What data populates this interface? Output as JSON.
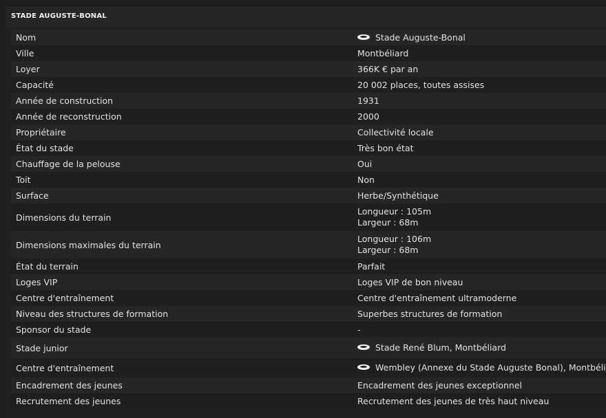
{
  "header": {
    "title": "STADE AUGUSTE-BONAL"
  },
  "rows": [
    {
      "label": "Nom",
      "value": [
        "Stade Auguste-Bonal"
      ],
      "icon": "stadium-icon",
      "h": 23
    },
    {
      "label": "Ville",
      "value": [
        "Montbéliard"
      ],
      "h": 23
    },
    {
      "label": "Loyer",
      "value": [
        "366K € par an"
      ],
      "h": 23
    },
    {
      "label": "Capacité",
      "value": [
        "20 002 places, toutes assises"
      ],
      "h": 23
    },
    {
      "label": "Année de construction",
      "value": [
        "1931"
      ],
      "h": 23
    },
    {
      "label": "Année de reconstruction",
      "value": [
        "2000"
      ],
      "h": 23
    },
    {
      "label": "Propriétaire",
      "value": [
        "Collectivité locale"
      ],
      "h": 23
    },
    {
      "label": "État du stade",
      "value": [
        "Très bon état"
      ],
      "h": 23
    },
    {
      "label": "Chauffage de la pelouse",
      "value": [
        "Oui"
      ],
      "h": 23
    },
    {
      "label": "Toit",
      "value": [
        "Non"
      ],
      "h": 23
    },
    {
      "label": "Surface",
      "value": [
        "Herbe/Synthétique"
      ],
      "h": 23
    },
    {
      "label": "Dimensions du terrain",
      "value": [
        "Longueur : 105m",
        "Largeur : 68m"
      ],
      "h": 40
    },
    {
      "label": "Dimensions maximales du terrain",
      "value": [
        "Longueur : 106m",
        "Largeur : 68m"
      ],
      "h": 40
    },
    {
      "label": "État du terrain",
      "value": [
        "Parfait"
      ],
      "h": 23
    },
    {
      "label": "Loges VIP",
      "value": [
        "Loges VIP de bon niveau"
      ],
      "h": 23
    },
    {
      "label": "Centre d'entraînement",
      "value": [
        "Centre d'entraînement ultramoderne"
      ],
      "h": 23
    },
    {
      "label": "Niveau des structures de formation",
      "value": [
        "Superbes structures de formation"
      ],
      "h": 23
    },
    {
      "label": "Sponsor du stade",
      "value": [
        "-"
      ],
      "h": 23
    },
    {
      "label": "Stade junior",
      "value": [
        "Stade René Blum, Montbéliard"
      ],
      "icon": "stadium-icon",
      "h": 30
    },
    {
      "label": "Centre d'entraînement",
      "value": [
        "Wembley (Annexe du Stade Auguste Bonal), Montbéliard"
      ],
      "icon": "stadium-icon",
      "h": 28
    },
    {
      "label": "Encadrement des jeunes",
      "value": [
        "Encadrement des jeunes exceptionnel"
      ],
      "h": 23
    },
    {
      "label": "Recrutement des jeunes",
      "value": [
        "Recrutement des jeunes de très haut niveau"
      ],
      "h": 23
    }
  ]
}
